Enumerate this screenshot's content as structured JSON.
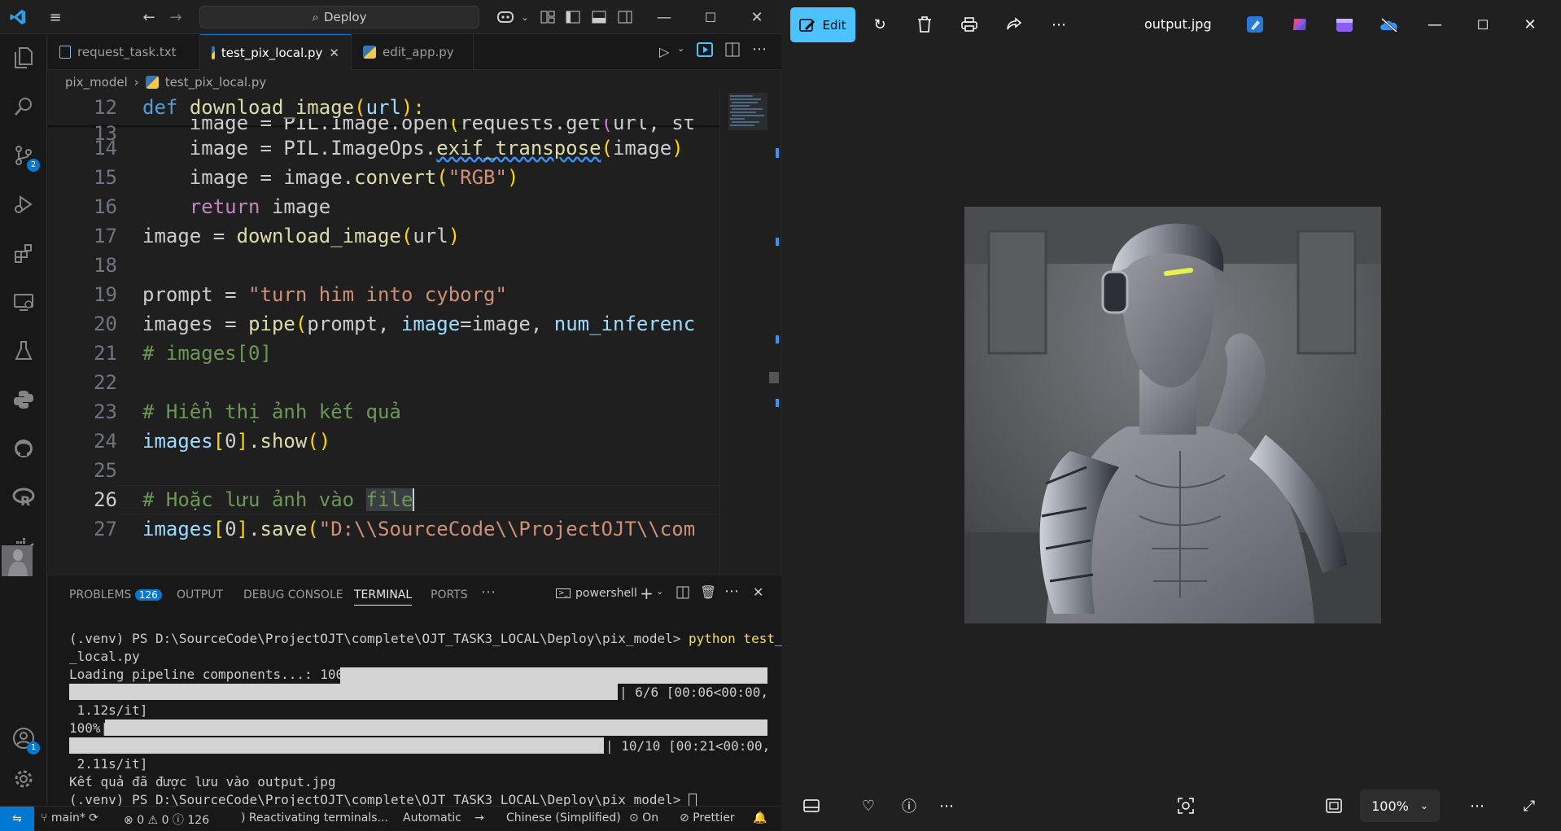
{
  "vscode": {
    "search_text": "Deploy",
    "tabs": [
      {
        "label": "request_task.txt"
      },
      {
        "label": "test_pix_local.py"
      },
      {
        "label": "edit_app.py"
      }
    ],
    "breadcrumb": {
      "folder": "pix_model",
      "file": "test_pix_local.py"
    },
    "badges": {
      "source_control": "2",
      "accounts": "1"
    },
    "code": {
      "ln12": "12",
      "ln13": "13",
      "ln14": "14",
      "ln15": "15",
      "ln16": "16",
      "ln17": "17",
      "ln18": "18",
      "ln19": "19",
      "ln20": "20",
      "ln21": "21",
      "ln22": "22",
      "ln23": "23",
      "ln24": "24",
      "ln25": "25",
      "ln26": "26",
      "ln27": "27",
      "l12": {
        "a": "def",
        "b": " ",
        "c": "download_image",
        "d": "(",
        "e": "url",
        "f": "):"
      },
      "l13": {
        "a": "    image = PIL.Image.open",
        "b": "(",
        "c": "requests.get",
        "d": "(",
        "e": "url, st"
      },
      "l14": {
        "a": "    image = PIL.ImageOps.",
        "b": "exif_transpose",
        "c": "(",
        "d": "image",
        "e": ")"
      },
      "l15": {
        "a": "    image = image.",
        "b": "convert",
        "c": "(",
        "d": "\"RGB\"",
        "e": ")"
      },
      "l16": {
        "a": "    ",
        "b": "return",
        "c": " image"
      },
      "l17": {
        "a": "image = ",
        "b": "download_image",
        "c": "(",
        "d": "url",
        "e": ")"
      },
      "l19": {
        "a": "prompt",
        "b": " = ",
        "c": "\"turn him into cyborg\""
      },
      "l20": {
        "a": "images",
        "b": " = ",
        "c": "pipe",
        "d": "(",
        "e": "prompt, ",
        "f": "image",
        "g": "=image, ",
        "h": "num_inferenc"
      },
      "l21": "# images[0]",
      "l23": "# Hiển thị ảnh kết quả",
      "l24": {
        "a": "images",
        "b": "[",
        "c": "0",
        "d": "]",
        "e": ".show",
        "f": "()"
      },
      "l26a": "# Hoặc lưu ảnh vào ",
      "l26b": "file",
      "l27": {
        "a": "images",
        "b": "[",
        "c": "0",
        "d": "]",
        "e": ".save",
        "f": "(",
        "g": "\"D:\\\\SourceCode\\\\ProjectOJT\\\\com"
      }
    },
    "panel": {
      "tabs": [
        "PROBLEMS",
        "OUTPUT",
        "DEBUG CONSOLE",
        "TERMINAL",
        "PORTS"
      ],
      "problems_count": "126",
      "shell": "powershell"
    },
    "terminal": {
      "prompt1": "(.venv) PS D:\\SourceCode\\ProjectOJT\\complete\\OJT_TASK3_LOCAL\\Deploy\\pix_model> ",
      "cmd1": "python test_pix",
      "cmd1b": "_local.py",
      "load": "Loading pipeline components...: 100%|",
      "load_end": "| 6/6 [00:06<00:00,",
      "load_rate": " 1.12s/it]",
      "prog": "100%|",
      "prog_end": "| 10/10 [00:21<00:00,",
      "prog_rate": " 2.11s/it]",
      "result": "Kết quả đã được lưu vào output.jpg",
      "prompt2": "(.venv) PS D:\\SourceCode\\ProjectOJT\\complete\\OJT_TASK3_LOCAL\\Deploy\\pix_model> "
    },
    "status": {
      "branch": "main*",
      "errors": "0",
      "warnings": "0",
      "info": "126",
      "reactivating": "Reactivating terminals...",
      "eol": "Automatic",
      "lang": "Chinese (Simplified)",
      "copilot": "On",
      "prettier": "Prettier"
    }
  },
  "photos": {
    "edit_label": "Edit",
    "filename": "output.jpg",
    "zoom": "100%"
  }
}
